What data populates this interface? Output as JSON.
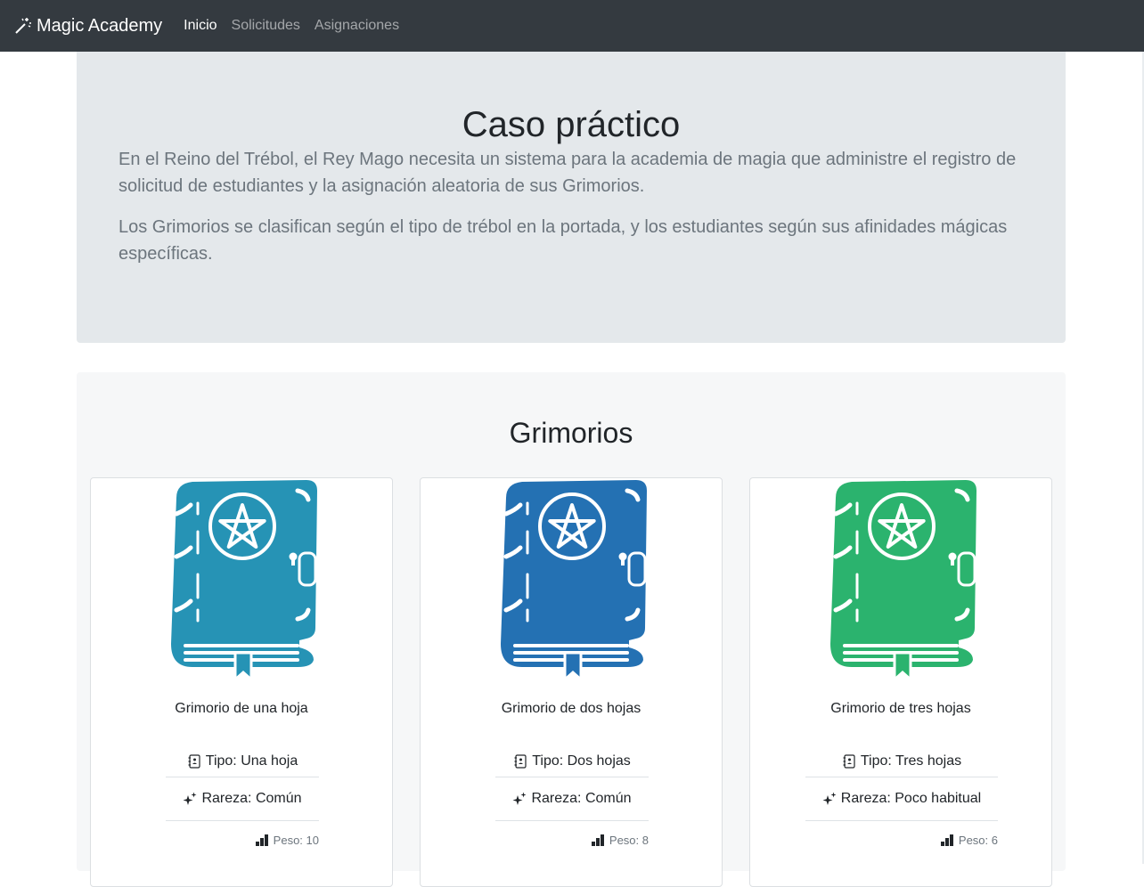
{
  "navbar": {
    "brand": "Magic Academy",
    "links": [
      {
        "label": "Inicio",
        "active": true
      },
      {
        "label": "Solicitudes",
        "active": false
      },
      {
        "label": "Asignaciones",
        "active": false
      }
    ]
  },
  "hero": {
    "title": "Caso práctico",
    "paragraphs": [
      "En el Reino del Trébol, el Rey Mago necesita un sistema para la academia de magia que administre el registro de solicitud de estudiantes y la asignación aleatoria de sus Grimorios.",
      "Los Grimorios se clasifican según el tipo de trébol en la portada, y los estudiantes según sus afinidades mágicas específicas."
    ]
  },
  "grimorios": {
    "title": "Grimorios",
    "cards": [
      {
        "name": "Grimorio de una hoja",
        "tipo": "Tipo: Una hoja",
        "rareza": "Rareza: Común",
        "peso": "Peso: 10",
        "color": "#2693b5"
      },
      {
        "name": "Grimorio de dos hojas",
        "tipo": "Tipo: Dos hojas",
        "rareza": "Rareza: Común",
        "peso": "Peso: 8",
        "color": "#2471b3"
      },
      {
        "name": "Grimorio de tres hojas",
        "tipo": "Tipo: Tres hojas",
        "rareza": "Rareza: Poco habitual",
        "peso": "Peso: 6",
        "color": "#2bb36e"
      }
    ]
  }
}
